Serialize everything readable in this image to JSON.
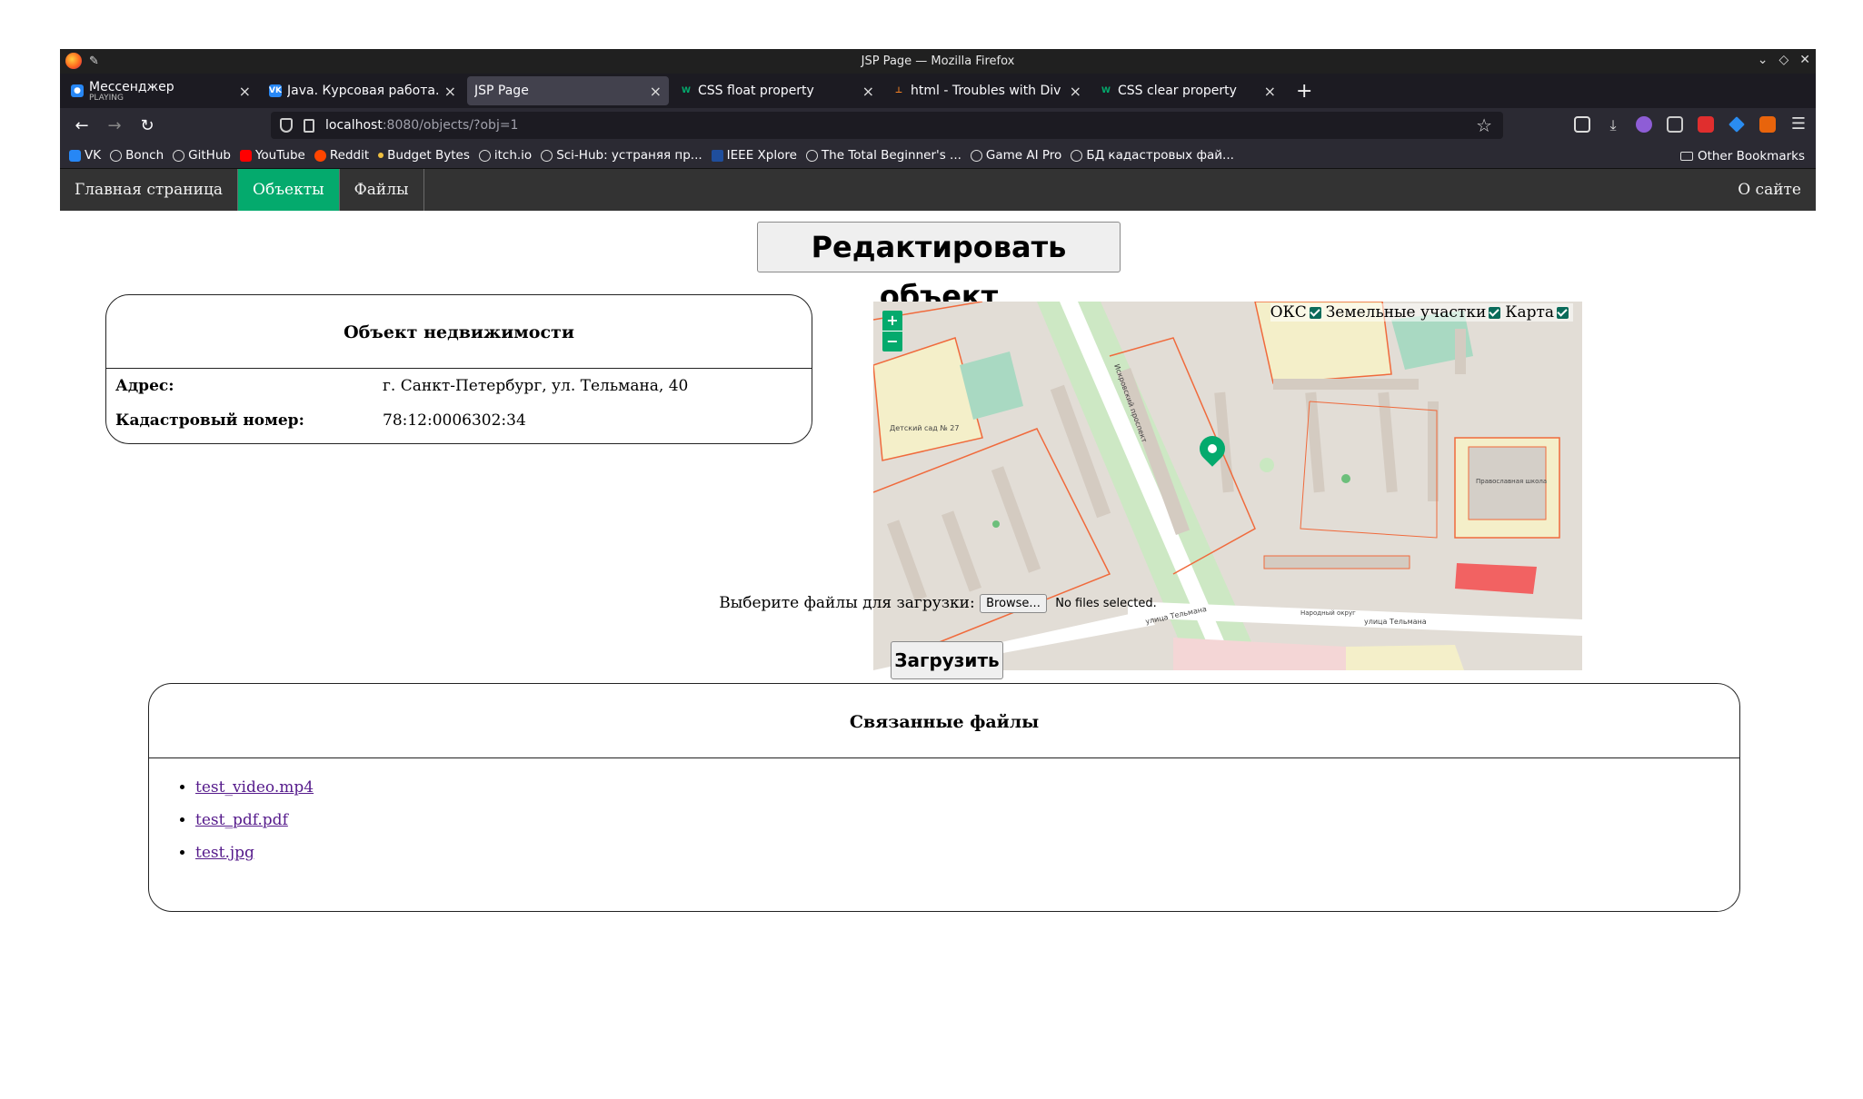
{
  "window": {
    "title": "JSP Page — Mozilla Firefox"
  },
  "tabs": [
    {
      "label": "Мессенджер",
      "sub": "PLAYING",
      "icon": "vk-messenger-icon",
      "color": "#2787f5",
      "active": false
    },
    {
      "label": "Java. Курсовая работа.pdf",
      "icon": "vk-icon",
      "color": "#2787f5",
      "active": false
    },
    {
      "label": "JSP Page",
      "active": true
    },
    {
      "label": "CSS float property",
      "icon": "w3schools-icon",
      "color": "#04aa6d",
      "active": false
    },
    {
      "label": "html - Troubles with Div afte",
      "icon": "stackoverflow-icon",
      "color": "#f48024",
      "active": false
    },
    {
      "label": "CSS clear property",
      "icon": "w3schools-icon",
      "color": "#04aa6d",
      "active": false
    }
  ],
  "url": {
    "host": "localhost",
    "path": ":8080/objects/?obj=1"
  },
  "bookmarks": [
    {
      "label": "VK",
      "icon": "vk-icon"
    },
    {
      "label": "Bonch",
      "icon": "globe-icon"
    },
    {
      "label": "GitHub",
      "icon": "github-icon"
    },
    {
      "label": "YouTube",
      "icon": "youtube-icon"
    },
    {
      "label": "Reddit",
      "icon": "reddit-icon"
    },
    {
      "label": "Budget Bytes",
      "icon": "budget-bytes-icon"
    },
    {
      "label": "itch.io",
      "icon": "globe-icon"
    },
    {
      "label": "Sci-Hub: устраняя пр...",
      "icon": "globe-icon"
    },
    {
      "label": "IEEE Xplore",
      "icon": "ieee-icon"
    },
    {
      "label": "The Total Beginner's ...",
      "icon": "globe-icon"
    },
    {
      "label": "Game AI Pro",
      "icon": "globe-icon"
    },
    {
      "label": "БД кадастровых фай...",
      "icon": "globe-icon"
    }
  ],
  "other_bookmarks": "Other Bookmarks",
  "site_nav": {
    "items": [
      "Главная страница",
      "Объекты",
      "Файлы"
    ],
    "active_index": 1,
    "about": "О сайте"
  },
  "edit_button": "Редактировать объект",
  "object": {
    "heading": "Объект недвижимости",
    "rows": [
      {
        "key": "Адрес:",
        "value": "г. Санкт-Петербург, ул. Тельмана, 40"
      },
      {
        "key": "Кадастровый номер:",
        "value": "78:12:0006302:34"
      }
    ]
  },
  "map": {
    "zoom_in": "+",
    "zoom_out": "−",
    "layers": [
      "ОКС",
      "Земельные участки",
      "Карта"
    ],
    "labels": {
      "kindergarten": "Детский сад № 27",
      "school": "Православная школа Невского",
      "street1": "улица Тельмана",
      "street2": "Искровский проспект",
      "street3": "Народный округ"
    }
  },
  "upload": {
    "label": "Выберите файлы для загрузки:",
    "browse": "Browse...",
    "status": "No files selected.",
    "submit": "Загрузить"
  },
  "files": {
    "heading": "Связанные файлы",
    "items": [
      "test_video.mp4",
      "test_pdf.pdf",
      "test.jpg"
    ]
  },
  "colors": {
    "accent": "#04aa6d",
    "nav_bg": "#333333",
    "link": "#551a8b"
  }
}
